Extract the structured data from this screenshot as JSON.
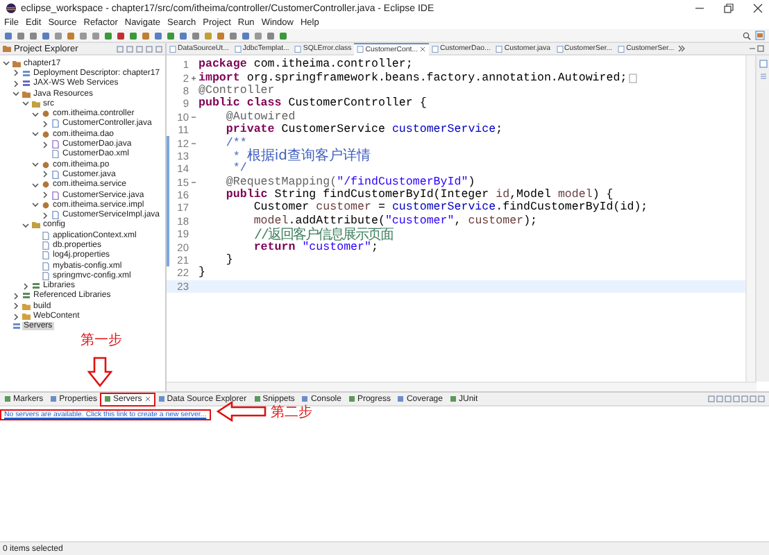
{
  "window": {
    "title": "eclipse_workspace - chapter17/src/com/itheima/controller/CustomerController.java - Eclipse IDE"
  },
  "menu": [
    "File",
    "Edit",
    "Source",
    "Refactor",
    "Navigate",
    "Search",
    "Project",
    "Run",
    "Window",
    "Help"
  ],
  "project_explorer": {
    "title": "Project Explorer",
    "items": [
      {
        "label": "chapter17",
        "kind": "project",
        "expanded": true,
        "selected": false,
        "children": [
          {
            "label": "Deployment Descriptor: chapter17",
            "kind": "descriptor",
            "expanded": false,
            "selected": false
          },
          {
            "label": "JAX-WS Web Services",
            "kind": "webservices",
            "expanded": false,
            "selected": false
          },
          {
            "label": "Java Resources",
            "kind": "javares",
            "expanded": true,
            "selected": false,
            "children": [
              {
                "label": "src",
                "kind": "srcfolder",
                "expanded": true,
                "selected": false,
                "children": [
                  {
                    "label": "com.itheima.controller",
                    "kind": "package",
                    "expanded": true,
                    "selected": false,
                    "children": [
                      {
                        "label": "CustomerController.java",
                        "kind": "java",
                        "expanded": false,
                        "selected": false
                      }
                    ]
                  },
                  {
                    "label": "com.itheima.dao",
                    "kind": "package",
                    "expanded": true,
                    "selected": false,
                    "children": [
                      {
                        "label": "CustomerDao.java",
                        "kind": "interface",
                        "expanded": false,
                        "selected": false
                      },
                      {
                        "label": "CustomerDao.xml",
                        "kind": "xml",
                        "selected": false
                      }
                    ]
                  },
                  {
                    "label": "com.itheima.po",
                    "kind": "package",
                    "expanded": true,
                    "selected": false,
                    "children": [
                      {
                        "label": "Customer.java",
                        "kind": "java",
                        "expanded": false,
                        "selected": false
                      }
                    ]
                  },
                  {
                    "label": "com.itheima.service",
                    "kind": "package",
                    "expanded": true,
                    "selected": false,
                    "children": [
                      {
                        "label": "CustomerService.java",
                        "kind": "interface",
                        "expanded": false,
                        "selected": false
                      }
                    ]
                  },
                  {
                    "label": "com.itheima.service.impl",
                    "kind": "package",
                    "expanded": true,
                    "selected": false,
                    "children": [
                      {
                        "label": "CustomerServiceImpl.java",
                        "kind": "java",
                        "expanded": false,
                        "selected": false
                      }
                    ]
                  }
                ]
              },
              {
                "label": "config",
                "kind": "srcfolder",
                "expanded": true,
                "selected": false,
                "children": [
                  {
                    "label": "applicationContext.xml",
                    "kind": "xml",
                    "selected": false
                  },
                  {
                    "label": "db.properties",
                    "kind": "properties",
                    "selected": false
                  },
                  {
                    "label": "log4j.properties",
                    "kind": "properties",
                    "selected": false
                  },
                  {
                    "label": "mybatis-config.xml",
                    "kind": "xml",
                    "selected": false
                  },
                  {
                    "label": "springmvc-config.xml",
                    "kind": "xml",
                    "selected": false
                  }
                ]
              },
              {
                "label": "Libraries",
                "kind": "library",
                "expanded": false,
                "selected": false
              }
            ]
          },
          {
            "label": "Referenced Libraries",
            "kind": "library",
            "expanded": false,
            "selected": false
          },
          {
            "label": "build",
            "kind": "folder",
            "expanded": false,
            "selected": false
          },
          {
            "label": "WebContent",
            "kind": "folder",
            "expanded": false,
            "selected": false
          }
        ]
      },
      {
        "label": "Servers",
        "kind": "servers",
        "selected": true
      }
    ]
  },
  "editor_tabs": [
    {
      "label": "DataSourceUt...",
      "selected": false
    },
    {
      "label": "JdbcTemplat...",
      "selected": false
    },
    {
      "label": "SQLError.class",
      "selected": false
    },
    {
      "label": "CustomerCont...",
      "selected": true
    },
    {
      "label": "CustomerDao...",
      "selected": false
    },
    {
      "label": "Customer.java",
      "selected": false
    },
    {
      "label": "CustomerSer...",
      "selected": false
    },
    {
      "label": "CustomerSer...",
      "selected": false
    }
  ],
  "code_lines": [
    {
      "number": "1",
      "changed": false,
      "current": false,
      "tokens": [
        {
          "kind": "keyword",
          "text": "package"
        },
        {
          "kind": "plain",
          "text": " com.itheima.controller;"
        }
      ]
    },
    {
      "number": "2",
      "folded": true,
      "changed": false,
      "current": false,
      "tokens": [
        {
          "kind": "keyword",
          "text": "import"
        },
        {
          "kind": "plain",
          "text": " org.springframework.beans.factory.annotation.Autowired;"
        }
      ]
    },
    {
      "number": "8",
      "changed": false,
      "current": false,
      "tokens": [
        {
          "kind": "annotation",
          "text": "@Controller"
        }
      ]
    },
    {
      "number": "9",
      "changed": false,
      "current": false,
      "tokens": [
        {
          "kind": "keyword",
          "text": "public class"
        },
        {
          "kind": "plain",
          "text": " CustomerController {"
        }
      ]
    },
    {
      "number": "10",
      "folded": false,
      "changed": false,
      "current": false,
      "tokens": [
        {
          "kind": "annotation",
          "text": "    @Autowired"
        }
      ]
    },
    {
      "number": "11",
      "changed": false,
      "current": false,
      "tokens": [
        {
          "kind": "keyword",
          "text": "    private"
        },
        {
          "kind": "plain",
          "text": " CustomerService "
        },
        {
          "kind": "field",
          "text": "customerService"
        },
        {
          "kind": "plain",
          "text": ";"
        }
      ]
    },
    {
      "number": "12",
      "folded": false,
      "changed": true,
      "current": false,
      "tokens": [
        {
          "kind": "javadoc",
          "text": "    /**"
        }
      ]
    },
    {
      "number": "13",
      "changed": true,
      "current": false,
      "tokens": [
        {
          "kind": "javadoc",
          "text": "     * "
        },
        {
          "kind": "javadoc_note",
          "text": "根据id查询客户详情"
        }
      ]
    },
    {
      "number": "14",
      "changed": true,
      "current": false,
      "tokens": [
        {
          "kind": "javadoc",
          "text": "     */"
        }
      ]
    },
    {
      "number": "15",
      "folded": false,
      "changed": true,
      "current": false,
      "tokens": [
        {
          "kind": "annotation",
          "text": "    @RequestMapping("
        },
        {
          "kind": "string",
          "text": "\"/findCustomerById\""
        },
        {
          "kind": "plain",
          "text": ")"
        }
      ]
    },
    {
      "number": "16",
      "changed": true,
      "current": false,
      "tokens": [
        {
          "kind": "keyword",
          "text": "    public"
        },
        {
          "kind": "plain",
          "text": " String findCustomerById(Integer "
        },
        {
          "kind": "local",
          "text": "id"
        },
        {
          "kind": "plain",
          "text": ",Model "
        },
        {
          "kind": "local",
          "text": "model"
        },
        {
          "kind": "plain",
          "text": ") {"
        }
      ]
    },
    {
      "number": "17",
      "changed": true,
      "current": false,
      "tokens": [
        {
          "kind": "plain",
          "text": "        Customer "
        },
        {
          "kind": "local",
          "text": "customer"
        },
        {
          "kind": "plain",
          "text": " = "
        },
        {
          "kind": "field",
          "text": "customerService"
        },
        {
          "kind": "plain",
          "text": ".findCustomerById(id);"
        }
      ]
    },
    {
      "number": "18",
      "changed": true,
      "current": false,
      "tokens": [
        {
          "kind": "local",
          "text": "        model"
        },
        {
          "kind": "plain",
          "text": ".addAttribute("
        },
        {
          "kind": "string",
          "text": "\"customer\""
        },
        {
          "kind": "plain",
          "text": ", "
        },
        {
          "kind": "local",
          "text": "customer"
        },
        {
          "kind": "plain",
          "text": ");"
        }
      ]
    },
    {
      "number": "19",
      "changed": true,
      "current": false,
      "tokens": [
        {
          "kind": "line_comment",
          "text": "        //返回客户信息展示页面"
        }
      ]
    },
    {
      "number": "20",
      "changed": true,
      "current": false,
      "tokens": [
        {
          "kind": "keyword",
          "text": "        return"
        },
        {
          "kind": "string",
          "text": " \"customer\""
        },
        {
          "kind": "plain",
          "text": ";"
        }
      ]
    },
    {
      "number": "21",
      "changed": true,
      "current": false,
      "tokens": [
        {
          "kind": "plain",
          "text": "    }"
        }
      ]
    },
    {
      "number": "22",
      "changed": false,
      "current": false,
      "tokens": [
        {
          "kind": "plain",
          "text": "}"
        }
      ]
    },
    {
      "number": "23",
      "changed": false,
      "current": true
    }
  ],
  "bottom_tabs": [
    {
      "label": "Markers",
      "selected": false,
      "highlighted": false
    },
    {
      "label": "Properties",
      "selected": false,
      "highlighted": false
    },
    {
      "label": "Servers",
      "selected": true,
      "highlighted": true
    },
    {
      "label": "Data Source Explorer",
      "selected": false,
      "highlighted": false
    },
    {
      "label": "Snippets",
      "selected": false,
      "highlighted": false
    },
    {
      "label": "Console",
      "selected": false,
      "highlighted": false
    },
    {
      "label": "Progress",
      "selected": false,
      "highlighted": false
    },
    {
      "label": "Coverage",
      "selected": false,
      "highlighted": false
    },
    {
      "label": "JUnit",
      "selected": false,
      "highlighted": false
    }
  ],
  "servers_view": {
    "link": "No servers are available. Click this link to create a new server...",
    "highlighted": true
  },
  "annotations": [
    {
      "text": "第一步",
      "kind": "arrow_down"
    },
    {
      "text": "第二步",
      "kind": "arrow_left"
    }
  ],
  "status_bar": {
    "text": "0 items selected"
  }
}
